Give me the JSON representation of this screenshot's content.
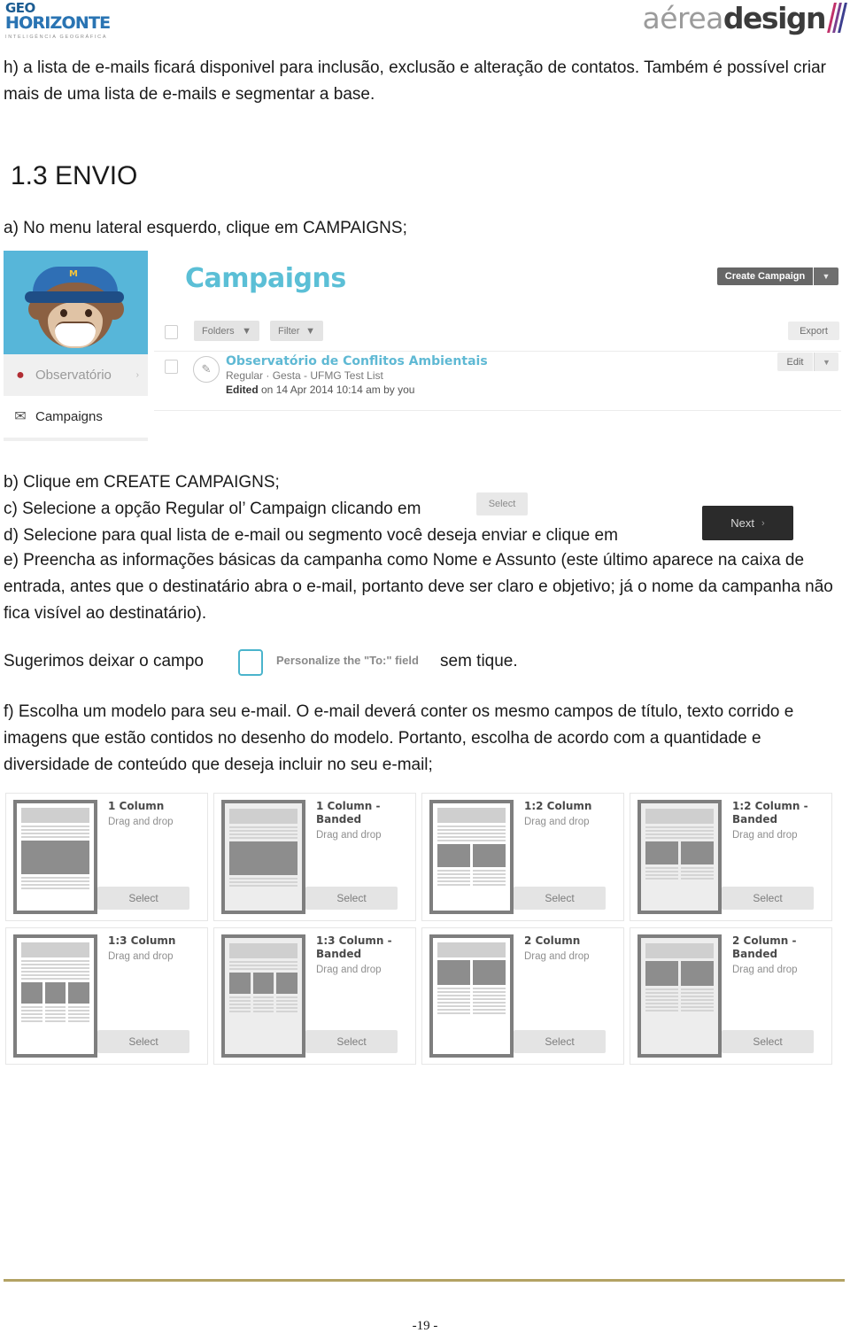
{
  "header": {
    "logo_left": {
      "line1": "GEO",
      "line2": "HORIZONTE",
      "line3": "INTELIGÊNCIA GEOGRÁFICA",
      "color": "#2a74b3"
    },
    "logo_right": {
      "word1": "aérea",
      "word2": "design",
      "colors": [
        "#c0306a",
        "#7a3f8f",
        "#3d3f8f"
      ]
    }
  },
  "body": {
    "intro": "h) a lista de e-mails ficará disponivel para inclusão, exclusão e alteração de contatos. Também é possível criar mais de uma lista de e-mails e segmentar a base.",
    "section_heading": "1.3 ENVIO",
    "step_a": "a) No menu lateral esquerdo, clique em CAMPAIGNS;",
    "step_b": "b) Clique em CREATE CAMPAIGNS;",
    "step_c": "c) Selecione a opção Regular ol’ Campaign clicando em",
    "step_d": "d) Selecione para qual lista de e-mail ou segmento você deseja enviar e clique em",
    "step_e": "e) Preencha as informações básicas da campanha como Nome e Assunto (este último aparece na caixa de entrada, antes que o destinatário abra o e-mail, portanto deve ser claro e objetivo; já o nome da campanha não fica visível ao destinatário).",
    "suggestion_prefix": "Sugerimos deixar o campo",
    "suggestion_checkbox_label": "Personalize the \"To:\" field",
    "suggestion_suffix": "sem tique.",
    "step_f": "f) Escolha um modelo para seu e-mail. O e-mail deverá conter os mesmo campos de título, texto corrido e imagens que estão contidos no desenho do modelo. Portanto, escolha de acordo com a quantidade e diversidade de conteúdo que deseja incluir no seu e-mail;",
    "inline_select_label": "Select",
    "inline_next_label": "Next"
  },
  "mailchimp": {
    "page_title": "Campaigns",
    "sidebar": {
      "avatar_badge": "M",
      "items": [
        {
          "label": "Observatório",
          "icon": "pin-icon",
          "arrow": "›"
        },
        {
          "label": "Campaigns",
          "icon": "envelope-icon"
        }
      ]
    },
    "toolbar": {
      "create_campaign": "Create Campaign",
      "export": "Export",
      "folders": "Folders",
      "filter": "Filter"
    },
    "campaign_row": {
      "name": "Observatório de Conflitos Ambientais",
      "meta": "Regular · Gesta - UFMG Test List",
      "edited_label": "Edited",
      "edited_rest": " on 14 Apr 2014 10:14 am by you",
      "edit_button": "Edit"
    },
    "accent_color": "#5bbfd6"
  },
  "templates": {
    "select_label": "Select",
    "drag_label": "Drag and drop",
    "items": [
      {
        "name": "1 Column",
        "layout": "one-col",
        "banded": false
      },
      {
        "name": "1 Column -\nBanded",
        "layout": "one-col",
        "banded": true
      },
      {
        "name": "1:2 Column",
        "layout": "one-two-col",
        "banded": false
      },
      {
        "name": "1:2 Column -\nBanded",
        "layout": "one-two-col",
        "banded": true
      },
      {
        "name": "1:3 Column",
        "layout": "one-three-col",
        "banded": false
      },
      {
        "name": "1:3 Column -\nBanded",
        "layout": "one-three-col",
        "banded": true
      },
      {
        "name": "2 Column",
        "layout": "two-col",
        "banded": false
      },
      {
        "name": "2 Column -\nBanded",
        "layout": "two-col",
        "banded": true
      }
    ]
  },
  "footer": {
    "page_number": "-19 -",
    "rule_color": "#b3a264"
  }
}
